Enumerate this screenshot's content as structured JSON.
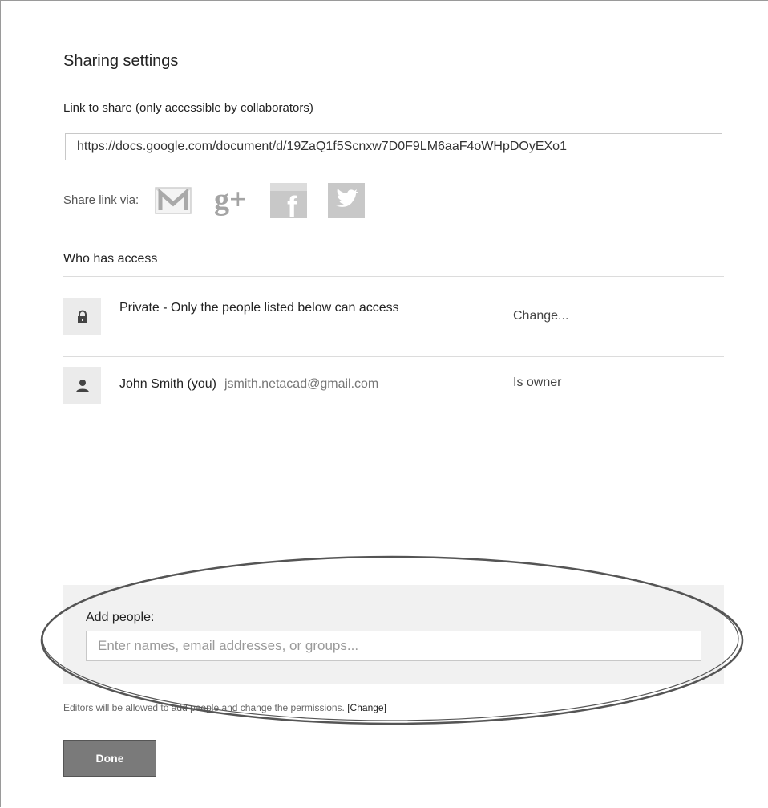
{
  "dialog": {
    "title": "Sharing settings"
  },
  "link": {
    "label": "Link to share (only accessible by collaborators)",
    "value": "https://docs.google.com/document/d/19ZaQ1f5Scnxw7D0F9LM6aaF4oWHpDOyEXo1"
  },
  "share_via": {
    "label": "Share link via:",
    "services": [
      {
        "name": "Gmail",
        "icon": "gmail-icon"
      },
      {
        "name": "Google+",
        "icon": "google-plus-icon"
      },
      {
        "name": "Facebook",
        "icon": "facebook-icon"
      },
      {
        "name": "Twitter",
        "icon": "twitter-icon"
      }
    ],
    "gplus_text": "g+",
    "facebook_text": "f"
  },
  "access": {
    "heading": "Who has access",
    "visibility": {
      "icon": "lock-icon",
      "text": "Private - Only the people listed below can access",
      "action": "Change..."
    },
    "owner": {
      "icon": "person-icon",
      "name": "John Smith (you)",
      "email": "jsmith.netacad@gmail.com",
      "role": "Is owner"
    }
  },
  "add_people": {
    "label": "Add people:",
    "placeholder": "Enter names, email addresses, or groups..."
  },
  "editors_note": {
    "text": "Editors will be allowed to add people and change the permissions. ",
    "change_link": "[Change]"
  },
  "done_button": {
    "label": "Done"
  },
  "colors": {
    "panel_bg": "#f1f1f1",
    "done_bg": "#7a7a7a",
    "icon_bg": "#ebebeb",
    "annotation_stroke": "#555555"
  }
}
